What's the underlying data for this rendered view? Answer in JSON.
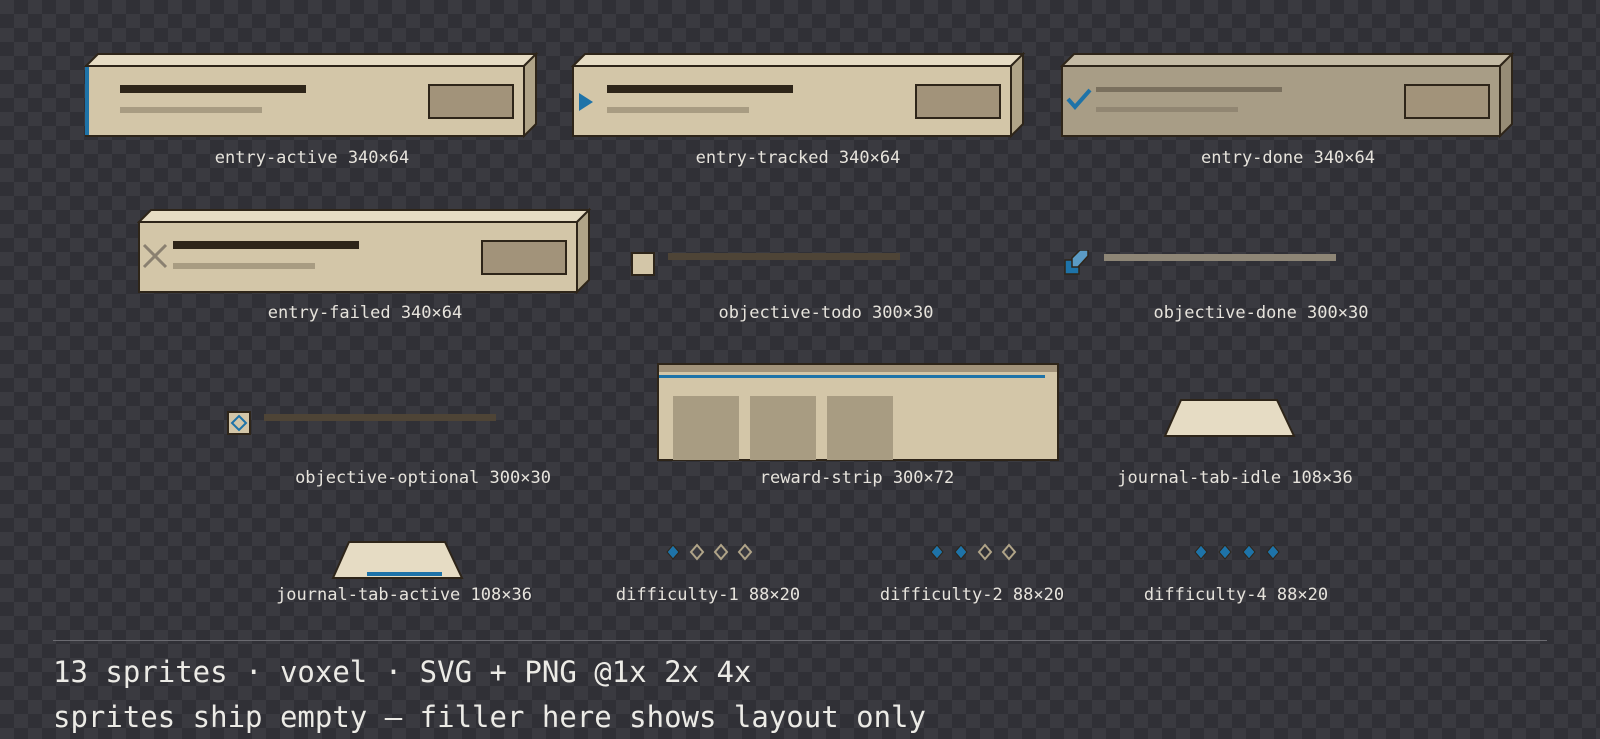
{
  "sprites": [
    {
      "name": "entry-active",
      "size": "340×64"
    },
    {
      "name": "entry-tracked",
      "size": "340×64"
    },
    {
      "name": "entry-done",
      "size": "340×64"
    },
    {
      "name": "entry-failed",
      "size": "340×64"
    },
    {
      "name": "objective-todo",
      "size": "300×30"
    },
    {
      "name": "objective-done",
      "size": "300×30"
    },
    {
      "name": "objective-optional",
      "size": "300×30"
    },
    {
      "name": "reward-strip",
      "size": "300×72"
    },
    {
      "name": "journal-tab-idle",
      "size": "108×36"
    },
    {
      "name": "journal-tab-active",
      "size": "108×36"
    },
    {
      "name": "difficulty-1",
      "size": "88×20"
    },
    {
      "name": "difficulty-2",
      "size": "88×20"
    },
    {
      "name": "difficulty-4",
      "size": "88×20"
    }
  ],
  "labels": {
    "entry_active": "entry-active 340×64",
    "entry_tracked": "entry-tracked 340×64",
    "entry_done": "entry-done 340×64",
    "entry_failed": "entry-failed 340×64",
    "objective_todo": "objective-todo 300×30",
    "objective_done": "objective-done 300×30",
    "objective_optional": "objective-optional 300×30",
    "reward_strip": "reward-strip 300×72",
    "journal_tab_idle": "journal-tab-idle 108×36",
    "journal_tab_active": "journal-tab-active 108×36",
    "difficulty_1": "difficulty-1 88×20",
    "difficulty_2": "difficulty-2 88×20",
    "difficulty_4": "difficulty-4 88×20"
  },
  "difficulty_levels": {
    "difficulty_1": 1,
    "difficulty_2": 2,
    "difficulty_4": 4,
    "max": 4
  },
  "footer": {
    "line1": "13 sprites · voxel · SVG + PNG @1x 2x 4x",
    "line2": "sprites ship empty — filler here shows layout only"
  },
  "colors": {
    "parchment": "#d3c6a8",
    "parchment_top": "#e6dcc4",
    "parchment_side": "#b0a488",
    "outline": "#2e2519",
    "ink": "#2e2519",
    "filler": "#a89c82",
    "slot": "#a2937a",
    "accent_blue": "#1e73a8",
    "done_tone": "#a89d86",
    "failed_mark": "#8a8070"
  },
  "icons": {
    "tracked": "triangle-pointer-icon",
    "done": "checkmark-icon",
    "failed": "x-cross-icon",
    "objective_todo": "empty-checkbox-icon",
    "objective_done": "checked-box-icon",
    "objective_optional": "diamond-box-icon",
    "difficulty": "diamond-pip-icon"
  }
}
